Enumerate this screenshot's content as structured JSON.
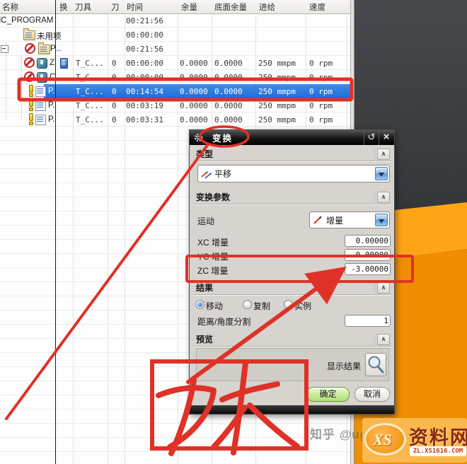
{
  "table": {
    "headers": [
      "名称",
      "换",
      "刀具",
      "刀",
      "时间",
      "余量",
      "底面余量",
      "进给",
      "速度"
    ],
    "rows": [
      {
        "name": "NC_PROGRAM",
        "tool": "",
        "tool_no": "",
        "time": "00:21:56",
        "stock": "",
        "floor_stock": "",
        "feed": "",
        "speed": ""
      },
      {
        "name": "未用项",
        "tool": "",
        "tool_no": "",
        "time": "00:00:00",
        "stock": "",
        "floor_stock": "",
        "feed": "",
        "speed": ""
      },
      {
        "name": "P...",
        "tool": "",
        "tool_no": "",
        "time": "00:21:56",
        "stock": "",
        "floor_stock": "",
        "feed": "",
        "speed": ""
      },
      {
        "name": "Z.",
        "tool": "T_C...",
        "tool_no": "0",
        "time": "00:00:00",
        "stock": "0.0000",
        "floor_stock": "0.0000",
        "feed": "250 mmpm",
        "speed": "0 rpm"
      },
      {
        "name": "C.",
        "tool": "T_C...",
        "tool_no": "0",
        "time": "00:00:00",
        "stock": "0.0000",
        "floor_stock": "0.0000",
        "feed": "250 mmpm",
        "speed": "0 rpm"
      },
      {
        "name": "P.",
        "tool": "T_C...",
        "tool_no": "0",
        "time": "00:14:54",
        "stock": "0.0000",
        "floor_stock": "0.0000",
        "feed": "250 mmpm",
        "speed": "0 rpm"
      },
      {
        "name": "P.",
        "tool": "T_C...",
        "tool_no": "0",
        "time": "00:03:19",
        "stock": "0.0000",
        "floor_stock": "0.0000",
        "feed": "250 mmpm",
        "speed": "0 rpm"
      },
      {
        "name": "P.",
        "tool": "T_C...",
        "tool_no": "0",
        "time": "00:03:31",
        "stock": "0.0000",
        "floor_stock": "0.0000",
        "feed": "250 mmpm",
        "speed": "0 rpm"
      }
    ]
  },
  "dialog": {
    "title": "变换",
    "type_section": "类型",
    "type_value": "平移",
    "params_section": "变换参数",
    "motion_label": "运动",
    "motion_value": "增量",
    "xc_label": "XC 增量",
    "xc_value": "0.00000",
    "yc_label": "YC 增量",
    "yc_value": "0.00000",
    "zc_label": "ZC 增量",
    "zc_value": "-3.00000",
    "result_section": "结果",
    "radio_move": "移动",
    "radio_copy": "复制",
    "radio_instance": "实例",
    "division_label": "距离/角度分割",
    "division_value": "1",
    "preview_section": "预览",
    "show_result_label": "显示结果",
    "ok_label": "确定",
    "cancel_label": "取消"
  },
  "annotations": {
    "handwritten_text": "刀长",
    "circled_text": "变换",
    "color": "#e03128"
  },
  "watermark": {
    "zhihu_text": "知乎 @ug",
    "logo_mark": "XS",
    "logo_title": "资料网",
    "logo_sub": "ZL.XS1616.COM"
  }
}
